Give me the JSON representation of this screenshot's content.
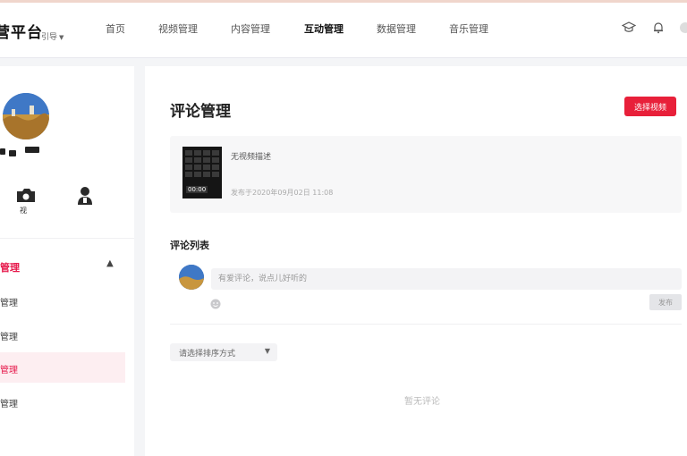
{
  "header": {
    "brand": "营平台",
    "brand_sub": "引导",
    "nav": [
      "首页",
      "视频管理",
      "内容管理",
      "互动管理",
      "数据管理",
      "音乐管理"
    ],
    "active_nav": "互动管理",
    "icons": [
      "graduation-cap-icon",
      "bell-icon"
    ]
  },
  "sidebar": {
    "quick_actions": [
      {
        "icon": "camera-icon",
        "label": "视"
      },
      {
        "icon": "person-icon",
        "label": ""
      }
    ],
    "group": {
      "label": "管理",
      "expanded": true
    },
    "items": [
      {
        "label": "管理",
        "active": false
      },
      {
        "label": "管理",
        "active": false
      },
      {
        "label": "管理",
        "active": true
      },
      {
        "label": "管理",
        "active": false
      }
    ]
  },
  "main": {
    "title": "评论管理",
    "select_video_button": "选择视频",
    "video": {
      "title": "无视频描述",
      "thumb_tag": "00:00",
      "published_at": "发布于2020年09月02日 11:08"
    },
    "comments": {
      "section_title": "评论列表",
      "input_placeholder": "有爱评论，说点儿好听的",
      "send_button": "发布",
      "sort_label": "请选择排序方式",
      "empty_text": "暂无评论"
    }
  },
  "colors": {
    "accent": "#e8203a",
    "active_bg": "#fdeef1",
    "page_bg": "#f4f5f7"
  }
}
